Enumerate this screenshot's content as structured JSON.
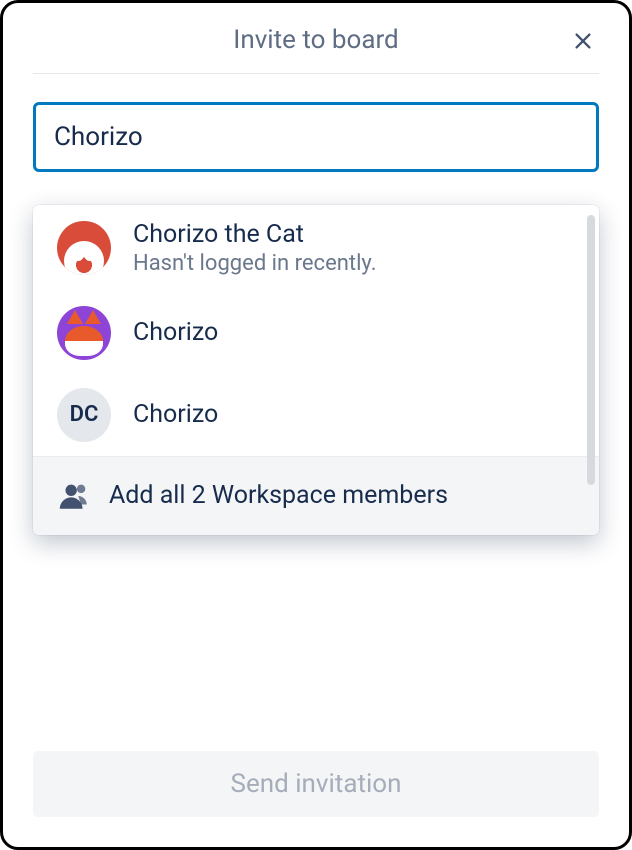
{
  "header": {
    "title": "Invite to board"
  },
  "search": {
    "value": "Chorizo"
  },
  "results": [
    {
      "name": "Chorizo the Cat",
      "meta": "Hasn't logged in recently.",
      "initials": ""
    },
    {
      "name": "Chorizo",
      "meta": "",
      "initials": ""
    },
    {
      "name": "Chorizo",
      "meta": "",
      "initials": "DC"
    }
  ],
  "addAll": {
    "label": "Add all 2 Workspace members"
  },
  "sendButton": {
    "label": "Send invitation"
  }
}
